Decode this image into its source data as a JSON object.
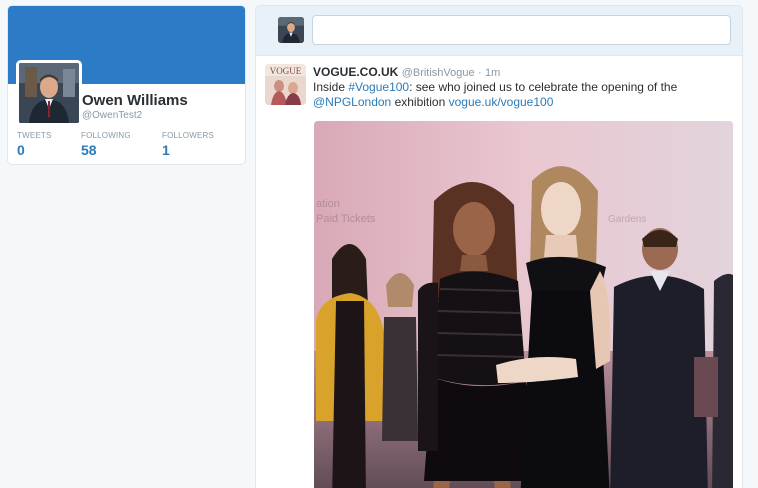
{
  "profile": {
    "name": "Owen Williams",
    "handle": "@OwenTest2",
    "stats": {
      "tweets": {
        "label": "TWEETS",
        "value": "0"
      },
      "following": {
        "label": "FOLLOWING",
        "value": "58"
      },
      "followers": {
        "label": "FOLLOWERS",
        "value": "1"
      }
    },
    "banner_color": "#2b7bc7"
  },
  "composer": {
    "value": "",
    "placeholder": ""
  },
  "tweet": {
    "author": "VOGUE.CO.UK",
    "handle": "@BritishVogue",
    "separator": "·",
    "time": "1m",
    "text_parts": {
      "p1": "Inside ",
      "hashtag": "#Vogue100",
      "p2": ": see who joined us to celebrate the opening of the ",
      "mention": "@NPGLondon",
      "p3": " exhibition ",
      "link": "vogue.uk/vogue100"
    },
    "avatar_logo": "VOGUE",
    "photo_wall_text": {
      "line1": "ation",
      "line2": "Paid Tickets",
      "line3": "Gardens"
    }
  },
  "colors": {
    "link": "#2b7bb9",
    "muted": "#8899a6",
    "text": "#292f33"
  }
}
